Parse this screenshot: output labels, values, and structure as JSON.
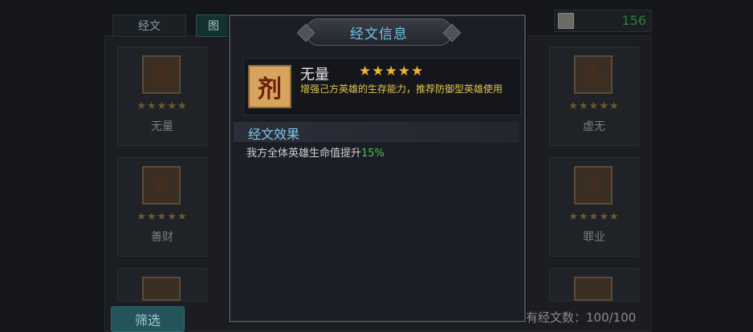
{
  "background": {
    "tabs": [
      {
        "label": "经文"
      },
      {
        "label": "图"
      }
    ],
    "currency_value": "156",
    "cards_left": [
      {
        "name": "无量",
        "glyph": "剂",
        "stars": "★★★★★"
      },
      {
        "name": "善财",
        "glyph": "£",
        "stars": "★★★★★"
      }
    ],
    "cards_right": [
      {
        "name": "虚无",
        "glyph": "ᗑ",
        "stars": "★★★★★"
      },
      {
        "name": "罪业",
        "glyph": "ᕽ",
        "stars": "★★★★★"
      }
    ],
    "filter_label": "筛选",
    "count_label": "有经文数：100/100"
  },
  "modal": {
    "title": "经文信息",
    "item": {
      "glyph": "剂",
      "name": "无量",
      "stars": "★★★★★",
      "star_count": 5,
      "description": "增强己方英雄的生存能力，推荐防御型英雄使用"
    },
    "effect_header": "经文效果",
    "effect_text": "我方全体英雄生命值提升",
    "effect_value": "15%"
  },
  "colors": {
    "title_text": "#6fc2e8",
    "star": "#f3b229",
    "description": "#e0c64a",
    "effect_value": "#4cc24c"
  }
}
